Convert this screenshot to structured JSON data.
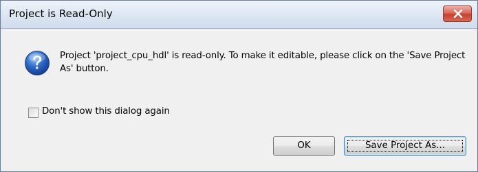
{
  "dialog": {
    "title": "Project is Read-Only",
    "close_icon": "close-x-icon",
    "message": "Project 'project_cpu_hdl' is read-only. To make it editable, please click on the 'Save Project As' button.",
    "message_icon": "question-icon",
    "checkbox": {
      "label": "Don't show this dialog again",
      "checked": false
    },
    "buttons": {
      "ok_label": "OK",
      "save_as_label": "Save Project As..."
    }
  },
  "colors": {
    "close_button": "#c7402e",
    "question_icon": "#2a5fb8",
    "dialog_background": "#f0f0f0"
  }
}
